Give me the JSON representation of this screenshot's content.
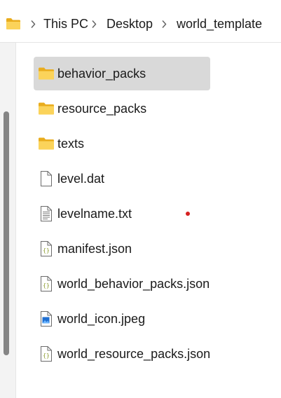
{
  "breadcrumb": {
    "root_icon": "folder-icon",
    "items": [
      "This PC",
      "Desktop",
      "world_template"
    ],
    "separator_icon": "chevron-right-icon"
  },
  "files": [
    {
      "name": "behavior_packs",
      "icon": "folder-icon",
      "selected": true
    },
    {
      "name": "resource_packs",
      "icon": "folder-icon"
    },
    {
      "name": "texts",
      "icon": "folder-icon"
    },
    {
      "name": "level.dat",
      "icon": "blank-file-icon"
    },
    {
      "name": "levelname.txt",
      "icon": "text-file-icon"
    },
    {
      "name": "manifest.json",
      "icon": "json-file-icon"
    },
    {
      "name": "world_behavior_packs.json",
      "icon": "json-file-icon"
    },
    {
      "name": "world_icon.jpeg",
      "icon": "image-file-icon"
    },
    {
      "name": "world_resource_packs.json",
      "icon": "json-file-icon"
    }
  ],
  "colors": {
    "selection": "#d9d9d9",
    "folder": "#f8c93e",
    "marker_dot": "#d62020"
  }
}
